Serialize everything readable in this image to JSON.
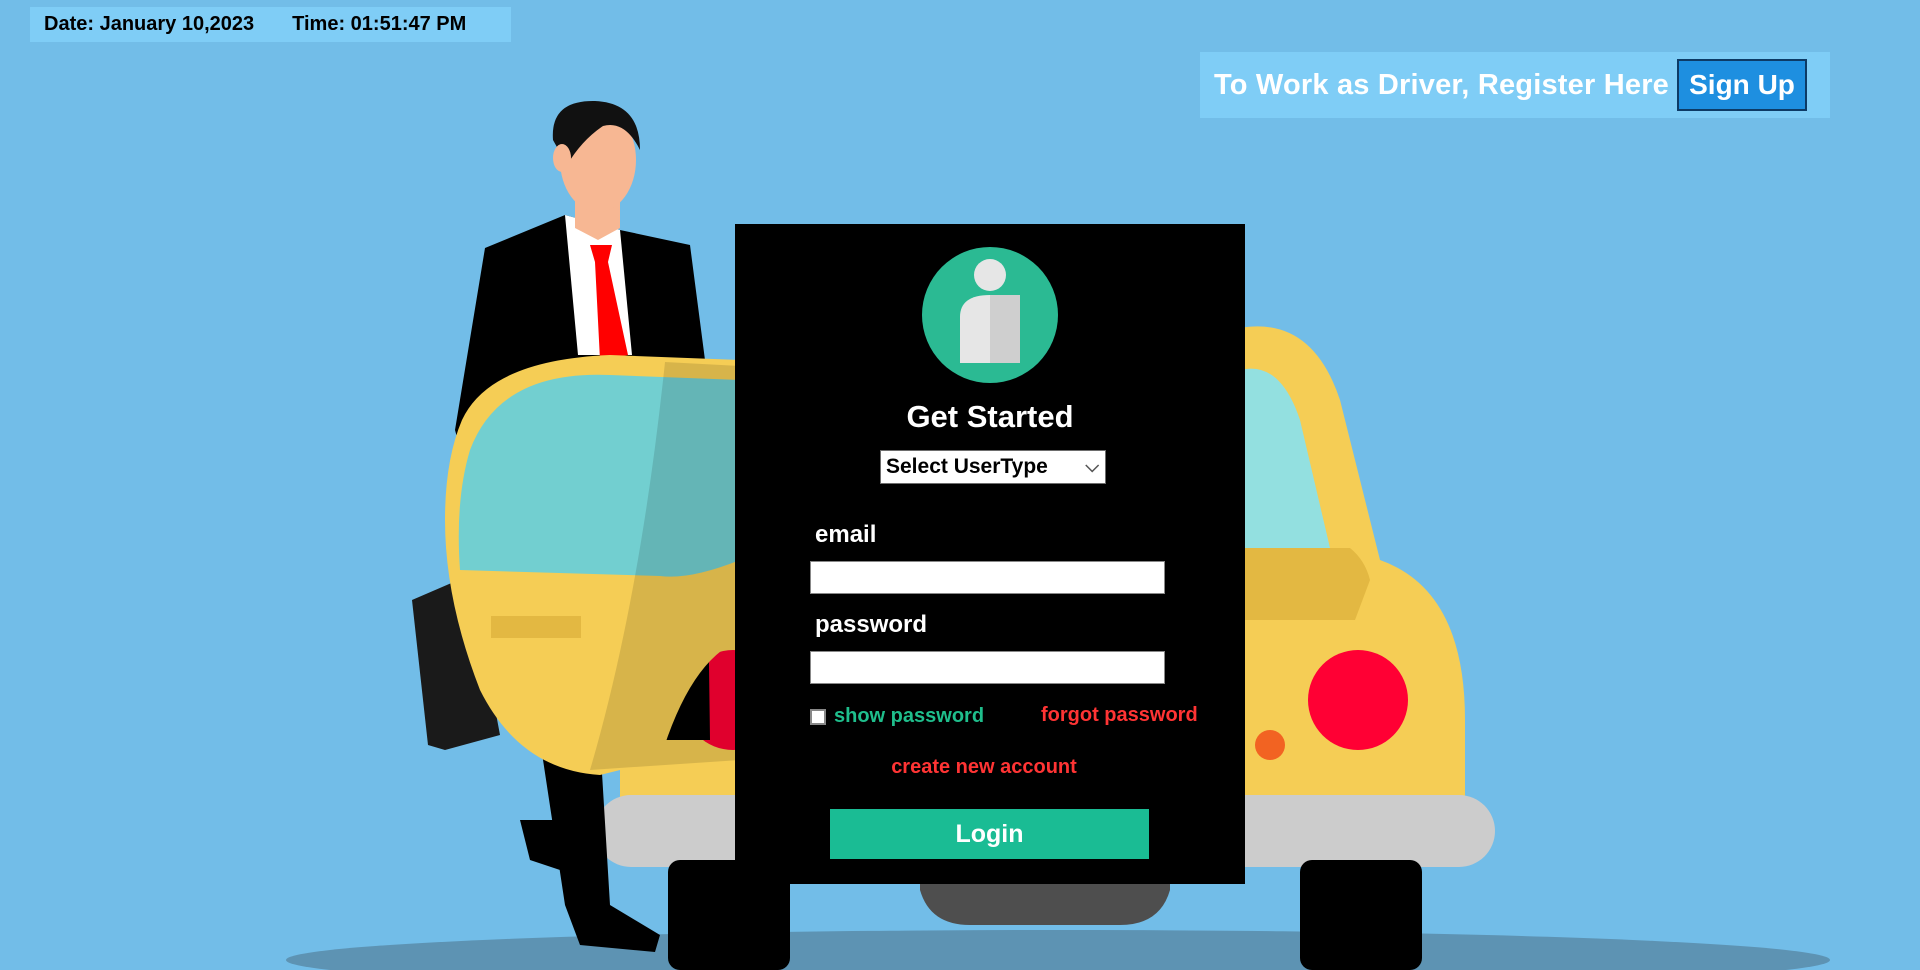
{
  "datetime": {
    "date": "Date: January 10,2023",
    "time": "Time: 01:51:47 PM"
  },
  "signup_banner": {
    "text": "To Work as Driver, Register Here",
    "button_label": "Sign Up"
  },
  "login_form": {
    "avatar_icon": "user-avatar-icon",
    "heading": "Get Started",
    "usertype_select": {
      "selected": "Select UserType",
      "chevron": "⌵"
    },
    "email_label": "email",
    "email_value": "",
    "password_label": "password",
    "password_value": "",
    "show_password_label": "show password",
    "show_password_checked": false,
    "forgot_password_label": "forgot password",
    "create_account_label": "create new account",
    "login_button_label": "Login"
  },
  "colors": {
    "background": "#72bde8",
    "banner": "#7fcdf6",
    "panel": "#000000",
    "accent_green": "#1abc94",
    "link_red": "#ff3434",
    "signup_blue": "#1e8fe0",
    "taxi_yellow": "#f5cd55"
  }
}
